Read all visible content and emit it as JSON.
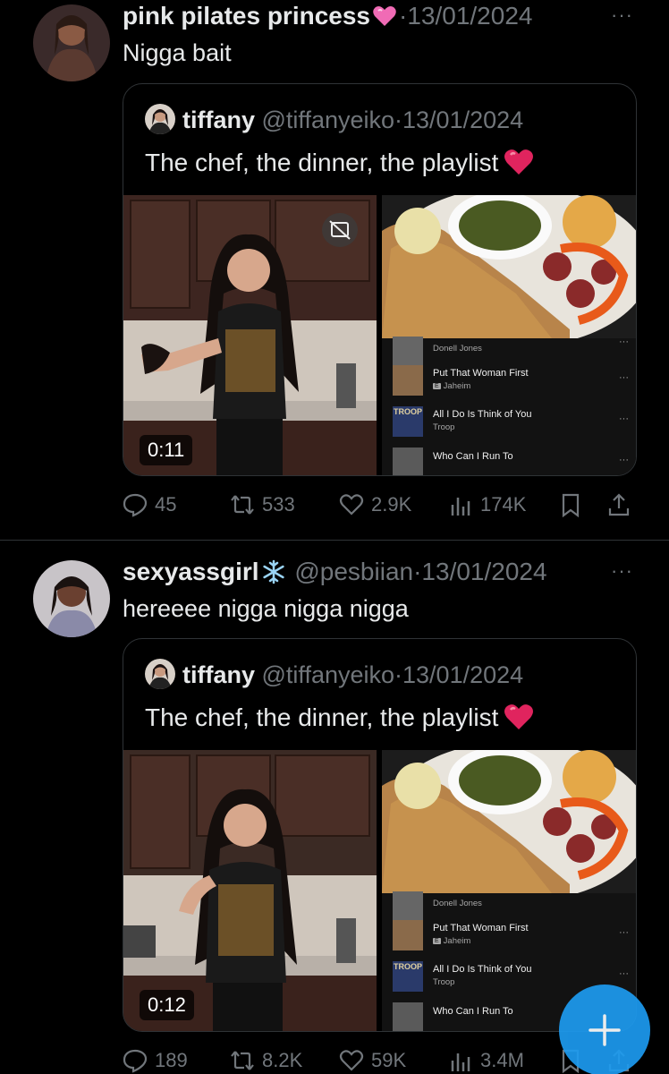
{
  "posts": [
    {
      "author": {
        "name": "pink pilates princess",
        "handle": "",
        "date": "13/01/2024",
        "emoji": "pink-heart"
      },
      "text": "Nigga bait",
      "quote": {
        "author": {
          "name": "tiffany",
          "handle": "@tiffanyeiko",
          "date": "13/01/2024"
        },
        "text": "The chef, the dinner, the playlist",
        "video_duration": "0:11",
        "playlist": [
          {
            "title": "",
            "artist": "Donell Jones",
            "explicit": false
          },
          {
            "title": "Put That Woman First",
            "artist": "Jaheim",
            "explicit": true
          },
          {
            "title": "All I Do Is Think of You",
            "artist": "Troop",
            "explicit": false
          },
          {
            "title": "Who Can I Run To",
            "artist": "",
            "explicit": false
          }
        ]
      },
      "stats": {
        "replies": "45",
        "reposts": "533",
        "likes": "2.9K",
        "views": "174K"
      }
    },
    {
      "author": {
        "name": "sexyassgirl",
        "handle": "@pesbiian",
        "date": "13/01/2024",
        "emoji": "snowflake"
      },
      "text": "hereeee nigga nigga nigga",
      "quote": {
        "author": {
          "name": "tiffany",
          "handle": "@tiffanyeiko",
          "date": "13/01/2024"
        },
        "text": "The chef, the dinner, the playlist",
        "video_duration": "0:12",
        "playlist": [
          {
            "title": "",
            "artist": "Donell Jones",
            "explicit": false
          },
          {
            "title": "Put That Woman First",
            "artist": "Jaheim",
            "explicit": true
          },
          {
            "title": "All I Do Is Think of You",
            "artist": "Troop",
            "explicit": false
          },
          {
            "title": "Who Can I Run To",
            "artist": "",
            "explicit": false
          }
        ]
      },
      "stats": {
        "replies": "189",
        "reposts": "8.2K",
        "likes": "59K",
        "views": "3.4M"
      }
    }
  ],
  "ui": {
    "more_label": "···",
    "separator_dot": "·",
    "explicit_badge": "E",
    "thumb_text_troop": "TROOP"
  },
  "colors": {
    "background": "#000000",
    "text": "#e7e9ea",
    "muted": "#71767b",
    "border": "#2f3336",
    "accent": "#1d9bf0",
    "heart": "#e0245e"
  }
}
